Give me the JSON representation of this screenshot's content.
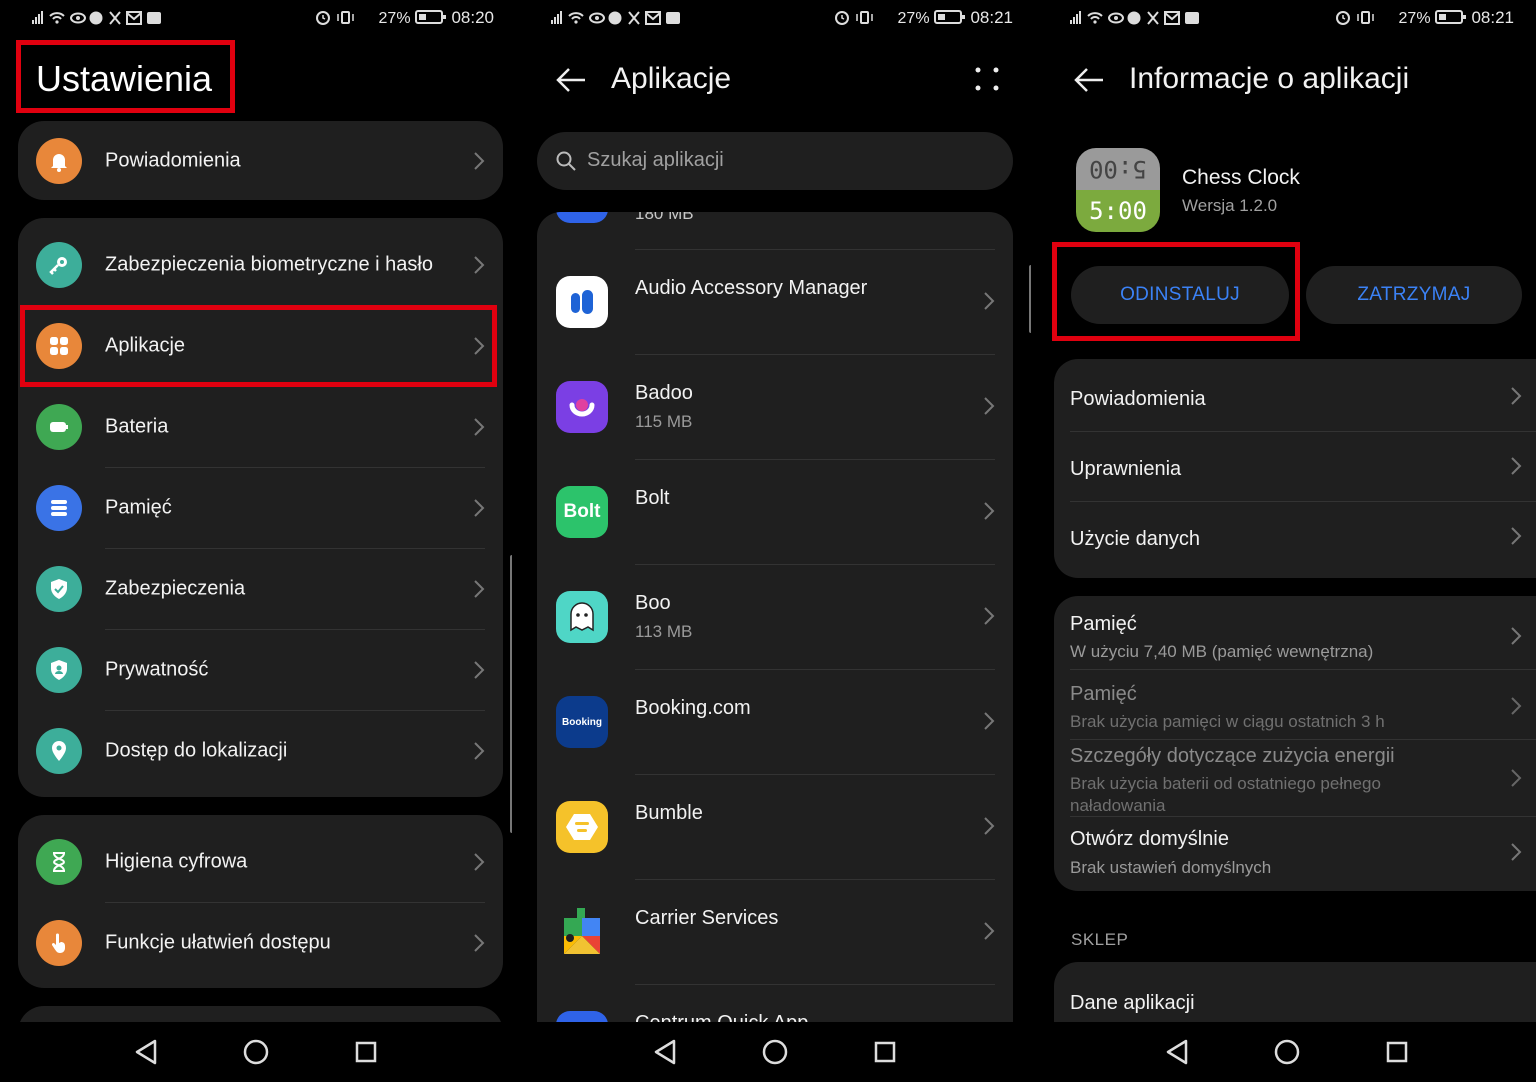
{
  "screen1": {
    "status": {
      "left_icons": "▐▐ ☷ ◉ Ⓜ ✕ ✉ ☰",
      "right": "⏰    ",
      "battery": "27%",
      "time": "08:20"
    },
    "title": "Ustawienia",
    "group1": [
      {
        "label": "Powiadomienia",
        "icon": "bell-icon",
        "color": "#e8873a"
      }
    ],
    "group2": [
      {
        "label": "Zabezpieczenia biometryczne i hasło",
        "icon": "key-icon",
        "color": "#3dae9a"
      },
      {
        "label": "Aplikacje",
        "icon": "apps-icon",
        "color": "#e8873a"
      },
      {
        "label": "Bateria",
        "icon": "battery-icon",
        "color": "#3fa853"
      },
      {
        "label": "Pamięć",
        "icon": "storage-icon",
        "color": "#3a73e6"
      },
      {
        "label": "Zabezpieczenia",
        "icon": "shield-icon",
        "color": "#3dae9a"
      },
      {
        "label": "Prywatność",
        "icon": "privacy-icon",
        "color": "#3dae9a"
      },
      {
        "label": "Dostęp do lokalizacji",
        "icon": "location-icon",
        "color": "#3dae9a"
      }
    ],
    "group3": [
      {
        "label": "Higiena cyfrowa",
        "icon": "hourglass-icon",
        "color": "#3fa853"
      },
      {
        "label": "Funkcje ułatwień dostępu",
        "icon": "hand-icon",
        "color": "#e8873a"
      }
    ]
  },
  "screen2": {
    "status": {
      "battery": "27%",
      "time": "08:21"
    },
    "title": "Aplikacje",
    "search_placeholder": "Szukaj aplikacji",
    "partial_top_size": "180 MB",
    "apps": [
      {
        "name": "Audio Accessory Manager",
        "size": "",
        "icon": "audio-accessory-icon",
        "bg": "#ffffff"
      },
      {
        "name": "Badoo",
        "size": "115 MB",
        "icon": "badoo-icon",
        "bg": "#7b3fe4"
      },
      {
        "name": "Bolt",
        "size": "",
        "icon": "bolt-icon",
        "bg": "#2cc36b"
      },
      {
        "name": "Boo",
        "size": "113 MB",
        "icon": "boo-icon",
        "bg": "#4fd6c6"
      },
      {
        "name": "Booking.com",
        "size": "",
        "icon": "booking-icon",
        "bg": "#0c3b8c"
      },
      {
        "name": "Bumble",
        "size": "",
        "icon": "bumble-icon",
        "bg": "#f5c22a"
      },
      {
        "name": "Carrier Services",
        "size": "",
        "icon": "carrier-services-icon",
        "bg": "transparent"
      }
    ],
    "partial_bottom_name": "Centrum Quick App",
    "bolt_logo": "Bolt",
    "booking_logo": "Booking"
  },
  "screen3": {
    "status": {
      "battery": "27%",
      "time": "08:21"
    },
    "title": "Informacje o aplikacji",
    "app_name": "Chess Clock",
    "app_version": "Wersja 1.2.0",
    "icon_top": "5:00",
    "icon_bottom": "5:00",
    "uninstall": "ODINSTALUJ",
    "stop": "ZATRZYMAJ",
    "card1": [
      "Powiadomienia",
      "Uprawnienia",
      "Użycie danych"
    ],
    "card2": [
      {
        "title": "Pamięć",
        "sub": "W użyciu 7,40 MB (pamięć wewnętrzna)",
        "dim": false
      },
      {
        "title": "Pamięć",
        "sub": "Brak użycia pamięci w ciągu ostatnich 3 h",
        "dim": true
      },
      {
        "title": "Szczegóły dotyczące zużycia energii",
        "sub": "Brak użycia baterii od ostatniego pełnego naładowania",
        "dim": true
      },
      {
        "title": "Otwórz domyślnie",
        "sub": "Brak ustawień domyślnych",
        "dim": false
      }
    ],
    "section": "SKLEP",
    "store_item": "Dane aplikacji"
  },
  "accent": "#3b82f6",
  "highlight": "#e0000f"
}
